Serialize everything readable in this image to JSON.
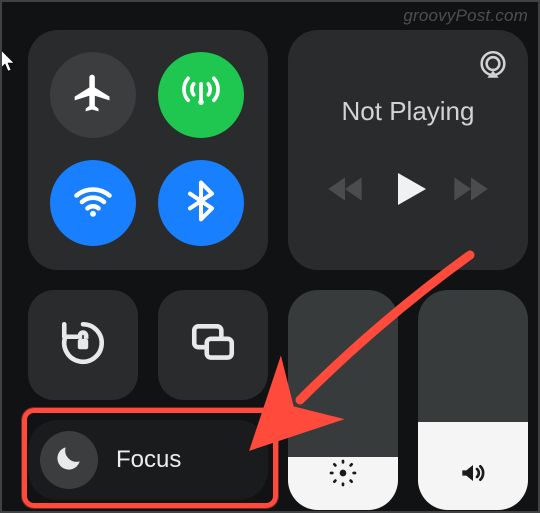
{
  "watermark": "groovyPost.com",
  "media": {
    "title": "Not Playing"
  },
  "focus": {
    "label": "Focus"
  },
  "icons": {
    "airplane": "airplane",
    "cellular": "cellular",
    "wifi": "wifi",
    "bluetooth": "bluetooth",
    "airplay": "airplay",
    "prev": "previous",
    "play": "play",
    "next": "next",
    "lock": "rotation-lock",
    "mirror": "screen-mirroring",
    "moon": "moon",
    "brightness": "brightness",
    "volume": "volume"
  }
}
